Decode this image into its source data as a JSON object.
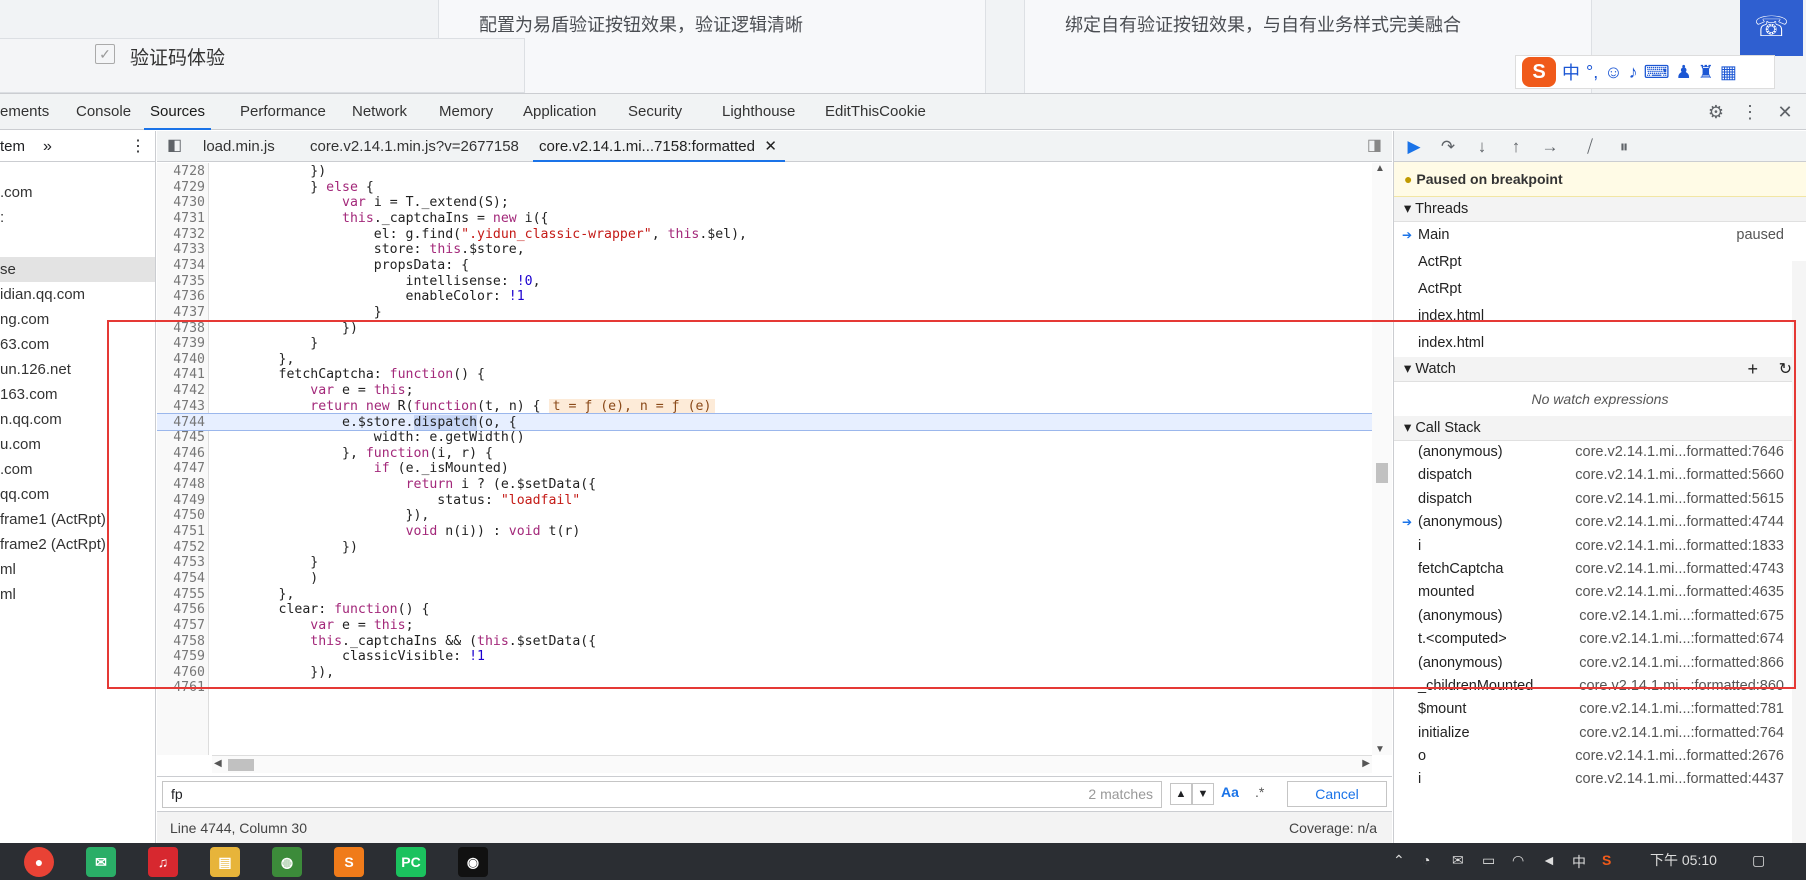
{
  "web": {
    "card1_text": "配置为易盾验证按钮效果，验证逻辑清晰",
    "card2_text": "绑定自有验证按钮效果，与自有业务样式完美融合",
    "captcha_label": "验证码体验",
    "ime_logo": "S",
    "ime_mode": "中"
  },
  "devtools": {
    "tabs": [
      "ements",
      "Console",
      "Sources",
      "Performance",
      "Network",
      "Memory",
      "Application",
      "Security",
      "Lighthouse",
      "EditThisCookie"
    ],
    "nav_header": "tem",
    "nav_items": [
      ".com",
      ":",
      "se",
      "idian.qq.com",
      "ng.com",
      "63.com",
      "un.126.net",
      "163.com",
      "n.qq.com",
      "u.com",
      ".com",
      "qq.com",
      "frame1 (ActRpt)",
      "frame2 (ActRpt)",
      "ml",
      "ml"
    ],
    "editor_tabs": [
      "load.min.js",
      "core.v2.14.1.min.js?v=2677158",
      "core.v2.14.1.mi...7158:formatted"
    ],
    "search_value": "fp",
    "search_matches": "2 matches",
    "cancel_label": "Cancel",
    "status_position": "Line 4744, Column 30",
    "status_coverage": "Coverage: n/a"
  },
  "code": [
    {
      "n": "4728",
      "t": "            })"
    },
    {
      "n": "4729",
      "t": "            } else {"
    },
    {
      "n": "4730",
      "t": "                var i = T._extend(S);"
    },
    {
      "n": "4731",
      "t": "                this._captchaIns = new i({"
    },
    {
      "n": "4732",
      "t": "                    el: g.find(\".yidun_classic-wrapper\", this.$el),"
    },
    {
      "n": "4733",
      "t": "                    store: this.$store,"
    },
    {
      "n": "4734",
      "t": "                    propsData: {"
    },
    {
      "n": "4735",
      "t": "                        intellisense: !0,"
    },
    {
      "n": "4736",
      "t": "                        enableColor: !1"
    },
    {
      "n": "4737",
      "t": "                    }"
    },
    {
      "n": "4738",
      "t": "                })"
    },
    {
      "n": "4739",
      "t": "            }"
    },
    {
      "n": "4740",
      "t": "        },"
    },
    {
      "n": "4741",
      "t": "        fetchCaptcha: function() {"
    },
    {
      "n": "4742",
      "t": "            var e = this;"
    },
    {
      "n": "4743",
      "t": "            return new R(function(t, n) {"
    },
    {
      "n": "4744",
      "t": "                e.$store.dispatch(o, {"
    },
    {
      "n": "4745",
      "t": "                    width: e.getWidth()"
    },
    {
      "n": "4746",
      "t": "                }, function(i, r) {"
    },
    {
      "n": "4747",
      "t": "                    if (e._isMounted)"
    },
    {
      "n": "4748",
      "t": "                        return i ? (e.$setData({"
    },
    {
      "n": "4749",
      "t": "                            status: \"loadfail\""
    },
    {
      "n": "4750",
      "t": "                        }),"
    },
    {
      "n": "4751",
      "t": "                        void n(i)) : void t(r)"
    },
    {
      "n": "4752",
      "t": "                })"
    },
    {
      "n": "4753",
      "t": "            }"
    },
    {
      "n": "4754",
      "t": "            )"
    },
    {
      "n": "4755",
      "t": "        },"
    },
    {
      "n": "4756",
      "t": "        clear: function() {"
    },
    {
      "n": "4757",
      "t": "            var e = this;"
    },
    {
      "n": "4758",
      "t": "            this._captchaIns && (this.$setData({"
    },
    {
      "n": "4759",
      "t": "                classicVisible: !1"
    },
    {
      "n": "4760",
      "t": "            }),"
    },
    {
      "n": "4761",
      "t": ""
    }
  ],
  "inline_values": "t = ƒ (e), n = ƒ (e)",
  "debugger": {
    "paused_text": "Paused on breakpoint",
    "threads_label": "Threads",
    "threads": [
      {
        "name": "Main",
        "state": "paused"
      },
      {
        "name": "ActRpt",
        "state": ""
      },
      {
        "name": "ActRpt",
        "state": ""
      },
      {
        "name": "index.html",
        "state": ""
      },
      {
        "name": "index.html",
        "state": ""
      }
    ],
    "watch_label": "Watch",
    "no_watch": "No watch expressions",
    "callstack_label": "Call Stack",
    "frames": [
      {
        "fn": "(anonymous)",
        "loc": "core.v2.14.1.mi...formatted:7646"
      },
      {
        "fn": "dispatch",
        "loc": "core.v2.14.1.mi...formatted:5660"
      },
      {
        "fn": "dispatch",
        "loc": "core.v2.14.1.mi...formatted:5615"
      },
      {
        "fn": "(anonymous)",
        "loc": "core.v2.14.1.mi...formatted:4744"
      },
      {
        "fn": "i",
        "loc": "core.v2.14.1.mi...formatted:1833"
      },
      {
        "fn": "fetchCaptcha",
        "loc": "core.v2.14.1.mi...formatted:4743"
      },
      {
        "fn": "mounted",
        "loc": "core.v2.14.1.mi...formatted:4635"
      },
      {
        "fn": "(anonymous)",
        "loc": "core.v2.14.1.mi...:formatted:675"
      },
      {
        "fn": "t.<computed>",
        "loc": "core.v2.14.1.mi...:formatted:674"
      },
      {
        "fn": "(anonymous)",
        "loc": "core.v2.14.1.mi...:formatted:866"
      },
      {
        "fn": "_childrenMounted",
        "loc": "core.v2.14.1.mi...:formatted:860"
      },
      {
        "fn": "$mount",
        "loc": "core.v2.14.1.mi...:formatted:781"
      },
      {
        "fn": "initialize",
        "loc": "core.v2.14.1.mi...:formatted:764"
      },
      {
        "fn": "o",
        "loc": "core.v2.14.1.mi...formatted:2676"
      },
      {
        "fn": "i",
        "loc": "core.v2.14.1.mi...formatted:4437"
      }
    ]
  },
  "taskbar": {
    "time": "下午 05:10"
  }
}
